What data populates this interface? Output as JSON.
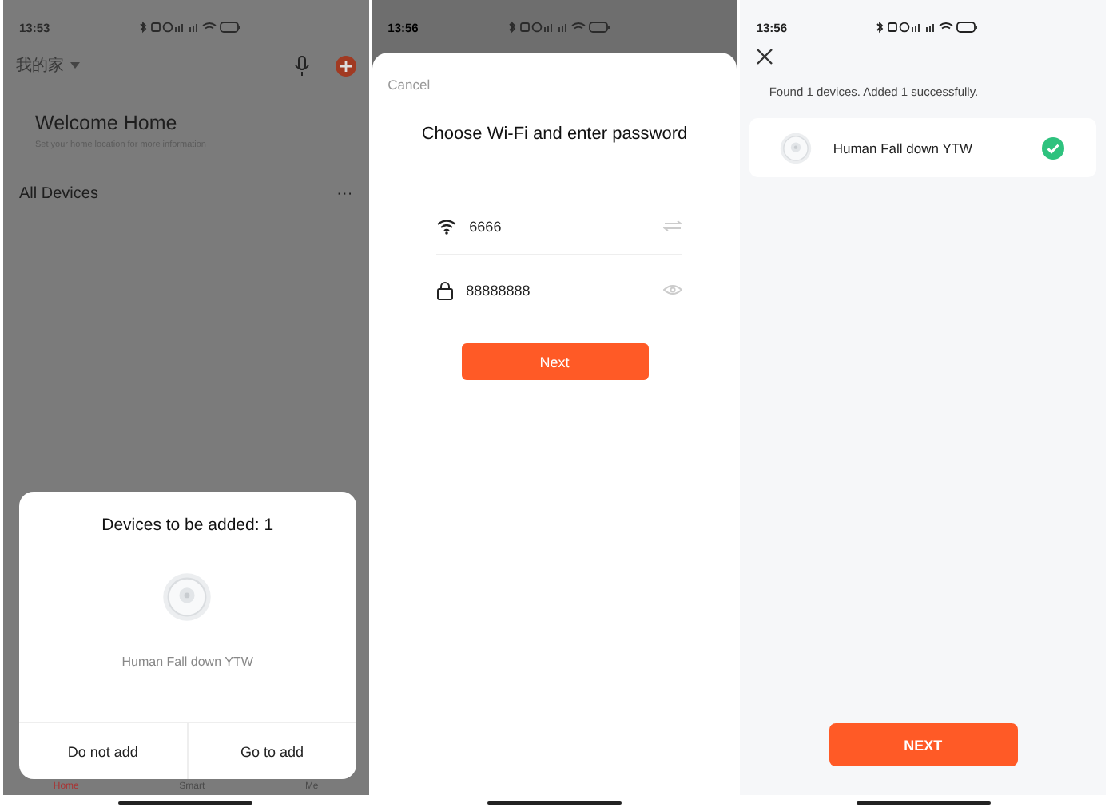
{
  "screens": [
    {
      "kind": "home",
      "status_time": "13:53",
      "home_name": "我的家",
      "welcome_title": "Welcome Home",
      "welcome_subtitle": "Set your home location for more information",
      "section_title": "All Devices",
      "more": "···",
      "dialog": {
        "title": "Devices to be added: 1",
        "device_name": "Human Fall down YTW",
        "buttons": [
          "Do not add",
          "Go to add"
        ]
      },
      "nav": [
        {
          "label": "Home",
          "selected": true
        },
        {
          "label": "Smart",
          "selected": false
        },
        {
          "label": "Me",
          "selected": false
        }
      ]
    },
    {
      "kind": "wifi",
      "status_time": "13:56",
      "cancel": "Cancel",
      "title": "Choose Wi-Fi and enter password",
      "ssid": "6666",
      "password": "88888888",
      "button": "Next"
    },
    {
      "kind": "result",
      "status_time": "13:56",
      "message": "Found 1 devices. Added 1 successfully.",
      "devices": [
        {
          "name": "Human Fall down YTW",
          "added": true
        }
      ],
      "button": "NEXT"
    }
  ]
}
